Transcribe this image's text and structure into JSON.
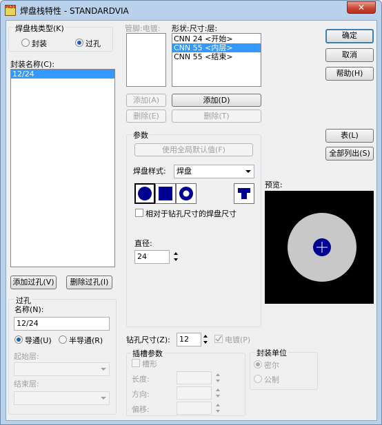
{
  "window": {
    "title": "焊盘栈特性 - STANDARDVIA",
    "close_glyph": "✕",
    "app_icon_text": "PADS"
  },
  "padstack_type": {
    "label": "焊盘栈类型(K)",
    "options": [
      {
        "label": "封装",
        "selected": false
      },
      {
        "label": "过孔",
        "selected": true
      }
    ]
  },
  "decal_name": {
    "label": "封装名称(C):",
    "items": [
      {
        "text": "12/24",
        "selected": true
      }
    ]
  },
  "pin_electrical": {
    "label": "管脚:电镀:"
  },
  "shape_size_layer": {
    "label": "形状:尺寸:层:",
    "items": [
      {
        "text": "CNN 24 <开始>",
        "selected": false
      },
      {
        "text": "CNN 55 <内层>",
        "selected": true
      },
      {
        "text": "CNN 55 <结束>",
        "selected": false
      }
    ]
  },
  "buttons": {
    "ok": "确定",
    "cancel": "取消",
    "help": "帮助(H)",
    "table": "表(L)",
    "list_all": "全部列出(S)",
    "add_left": "添加(A)",
    "delete_left": "删除(E)",
    "add_right": "添加(D)",
    "delete_right": "删除(T)",
    "add_via": "添加过孔(V)",
    "delete_via": "删除过孔(I)"
  },
  "params": {
    "label": "参数",
    "use_default": "使用全局默认值(F)",
    "pad_style_label": "焊盘样式:",
    "pad_style_value": "焊盘",
    "relative_drill_label": "相对于钻孔尺寸的焊盘尺寸",
    "diameter_label": "直径:",
    "diameter_value": "24"
  },
  "preview": {
    "label": "预览:",
    "pad_color": "#c8c8c8",
    "drill_color": "#000090"
  },
  "via": {
    "label": "过孔",
    "name_label": "名称(N):",
    "name_value": "12/24",
    "through_label": "导通(U)",
    "partial_label": "半导通(R)",
    "start_layer_label": "起始层:",
    "end_layer_label": "结束层:"
  },
  "drill": {
    "label": "钻孔尺寸(Z):",
    "value": "12",
    "plated_label": "电镀(P)"
  },
  "slot": {
    "label": "插槽参数",
    "slotted_label": "槽形",
    "length_label": "长度:",
    "orientation_label": "方向:",
    "offset_label": "偏移:"
  },
  "units": {
    "label": "封装单位",
    "mils": "密尔",
    "metric": "公制"
  }
}
